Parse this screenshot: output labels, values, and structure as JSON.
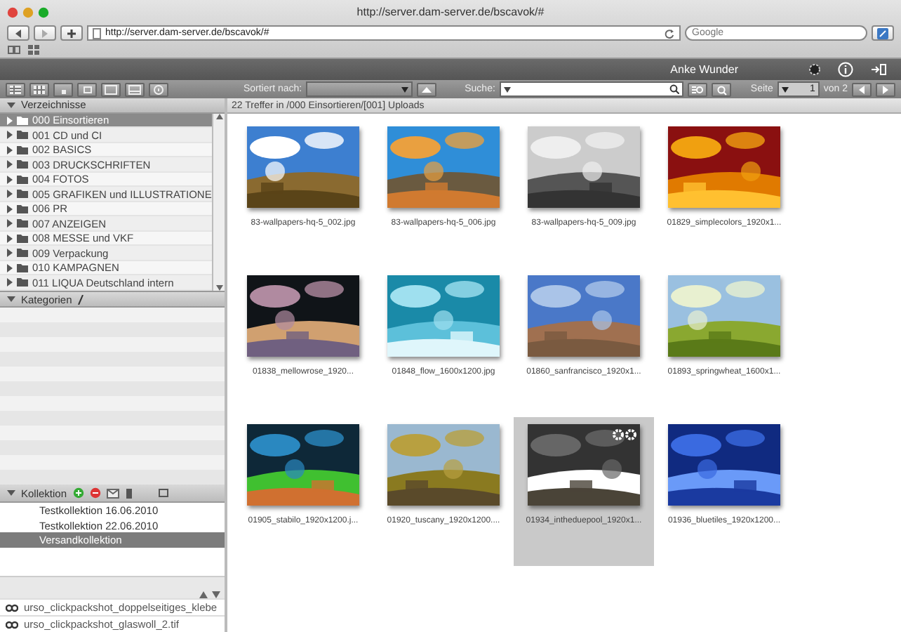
{
  "browser": {
    "title": "http://server.dam-server.de/bscavok/#",
    "url": "http://server.dam-server.de/bscavok/#",
    "search_placeholder": "Google"
  },
  "header": {
    "user": "Anke Wunder"
  },
  "toolbar": {
    "sort_label": "Sortiert nach:",
    "search_label": "Suche:",
    "page_label": "Seite",
    "page": "1",
    "page_total": "von 2"
  },
  "sidebar": {
    "folders_title": "Verzeichnisse",
    "folders": [
      {
        "label": "000 Einsortieren",
        "selected": true
      },
      {
        "label": "001 CD und CI",
        "selected": false
      },
      {
        "label": "002 BASICS",
        "selected": false
      },
      {
        "label": "003 DRUCKSCHRIFTEN",
        "selected": false
      },
      {
        "label": "004 FOTOS",
        "selected": false
      },
      {
        "label": "005 GRAFIKEN und ILLUSTRATIONE",
        "selected": false
      },
      {
        "label": "006 PR",
        "selected": false
      },
      {
        "label": "007 ANZEIGEN",
        "selected": false
      },
      {
        "label": "008 MESSE und VKF",
        "selected": false
      },
      {
        "label": "009 Verpackung",
        "selected": false
      },
      {
        "label": "010 KAMPAGNEN",
        "selected": false
      },
      {
        "label": "011 LIQUA Deutschland intern",
        "selected": false
      }
    ],
    "categories_title": "Kategorien",
    "collections_title": "Kollektion",
    "collections": [
      {
        "label": "Testkollektion 16.06.2010",
        "selected": false
      },
      {
        "label": "Testkollektion 22.06.2010",
        "selected": false
      },
      {
        "label": "Versandkollektion",
        "selected": true
      }
    ],
    "files": [
      "urso_clickpackshot_doppelseitiges_klebe",
      "urso_clickpackshot_glaswoll_2.tif"
    ]
  },
  "results": {
    "summary": "22 Treffer in /000 Einsortieren/[001] Uploads",
    "items": [
      {
        "label": "83-wallpapers-hq-5_002.jpg",
        "selected": false
      },
      {
        "label": "83-wallpapers-hq-5_006.jpg",
        "selected": false
      },
      {
        "label": "83-wallpapers-hq-5_009.jpg",
        "selected": false
      },
      {
        "label": "01829_simplecolors_1920x1...",
        "selected": false
      },
      {
        "label": "01838_mellowrose_1920...",
        "selected": false
      },
      {
        "label": "01848_flow_1600x1200.jpg",
        "selected": false
      },
      {
        "label": "01860_sanfrancisco_1920x1...",
        "selected": false
      },
      {
        "label": "01893_springwheat_1600x1...",
        "selected": false
      },
      {
        "label": "01905_stabilo_1920x1200.j...",
        "selected": false
      },
      {
        "label": "01920_tuscany_1920x1200....",
        "selected": false
      },
      {
        "label": "01934_intheduepool_1920x1...",
        "selected": true
      },
      {
        "label": "01936_bluetiles_1920x1200...",
        "selected": false
      }
    ]
  }
}
